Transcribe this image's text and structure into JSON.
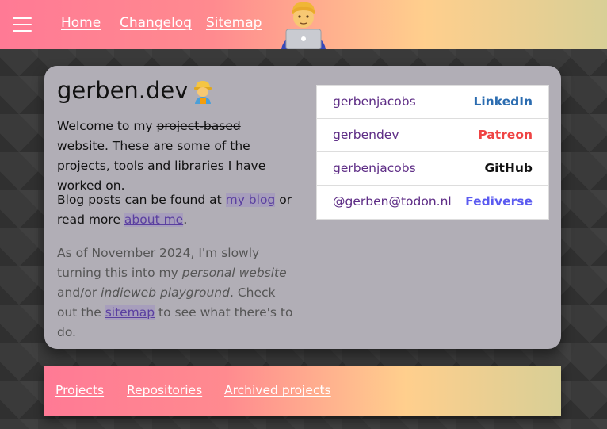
{
  "nav": {
    "items": [
      {
        "label": "Home"
      },
      {
        "label": "Changelog"
      },
      {
        "label": "Sitemap"
      }
    ]
  },
  "card": {
    "title": "gerben.dev",
    "intro": {
      "pre": "Welcome to my ",
      "struck": "project-based",
      "post": " website. These are some of the projects, tools and libraries I have worked on."
    },
    "blog": {
      "pre": "Blog posts can be found at ",
      "link1": "my blog",
      "mid": " or read more ",
      "link2": "about me",
      "post": "."
    },
    "note": {
      "pre": "As of November 2024, I'm slowly turning this into my ",
      "em1": "personal website",
      "mid": " and/or ",
      "em2": "indieweb playground",
      "mid2": ". Check out the ",
      "link": "sitemap",
      "post": " to see what there's to do."
    }
  },
  "social": [
    {
      "handle": "gerbenjacobs",
      "network": "LinkedIn",
      "color": "#2b6cb0"
    },
    {
      "handle": "gerbendev",
      "network": "Patreon",
      "color": "#ef4444"
    },
    {
      "handle": "gerbenjacobs",
      "network": "GitHub",
      "color": "#111111"
    },
    {
      "handle": "@gerben@todon.nl",
      "network": "Fediverse",
      "color": "#5b5bf0"
    }
  ],
  "tabs": [
    {
      "label": "Projects"
    },
    {
      "label": "Repositories"
    },
    {
      "label": "Archived projects"
    }
  ],
  "icons": {
    "menu": "hamburger-icon",
    "avatar": "person-with-laptop-icon",
    "worker": "construction-worker-emoji"
  }
}
